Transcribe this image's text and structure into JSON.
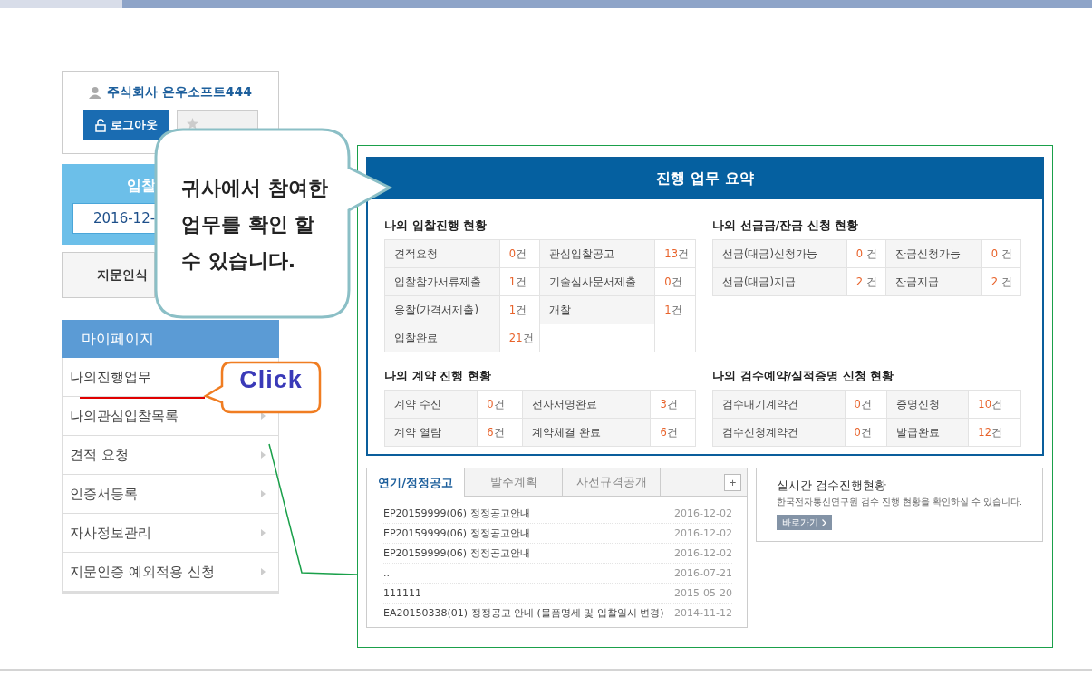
{
  "user": {
    "name": "주식회사 은우소프트444",
    "logout": "로그아웃"
  },
  "bid_box": {
    "title": "입찰",
    "date": "2016-12-"
  },
  "fingerprint_button": "지문인식",
  "mypage": {
    "title": "마이페이지",
    "items": [
      {
        "label": "나의진행업무"
      },
      {
        "label": "나의관심입찰목록",
        "arrow": true
      },
      {
        "label": "견적 요청",
        "arrow": true
      },
      {
        "label": "인증서등록",
        "arrow": true
      },
      {
        "label": "자사정보관리",
        "arrow": true
      },
      {
        "label": "지문인증 예외적용 신청",
        "arrow": true
      }
    ]
  },
  "summary": {
    "title": "진행 업무 요약",
    "sections": [
      {
        "title": "나의 입찰진행 현황",
        "rows": [
          [
            {
              "label": "견적요청",
              "count": "0",
              "unit": "건"
            },
            {
              "label": "관심입찰공고",
              "count": "13",
              "unit": "건"
            }
          ],
          [
            {
              "label": "입찰참가서류제출",
              "count": "1",
              "unit": "건"
            },
            {
              "label": "기술심사문서제출",
              "count": "0",
              "unit": "건"
            }
          ],
          [
            {
              "label": "응찰(가격서제출)",
              "count": "1",
              "unit": "건"
            },
            {
              "label": "개찰",
              "count": "1",
              "unit": "건"
            }
          ],
          [
            {
              "label": "입찰완료",
              "count": "21",
              "unit": "건"
            }
          ]
        ]
      },
      {
        "title": "나의 선급금/잔금 신청 현황",
        "rows": [
          [
            {
              "label": "선금(대금)신청가능",
              "count": "0",
              "unit": " 건"
            },
            {
              "label": "잔금신청가능",
              "count": "0",
              "unit": " 건"
            }
          ],
          [
            {
              "label": "선금(대금)지급",
              "count": "2",
              "unit": " 건"
            },
            {
              "label": "잔금지급",
              "count": "2",
              "unit": " 건"
            }
          ]
        ]
      },
      {
        "title": "나의 계약 진행 현황",
        "rows": [
          [
            {
              "label": "계약 수신",
              "count": "0",
              "unit": "건"
            },
            {
              "label": "전자서명완료",
              "count": "3",
              "unit": "건"
            }
          ],
          [
            {
              "label": "계약 열람",
              "count": "6",
              "unit": "건"
            },
            {
              "label": "계약체결 완료",
              "count": "6",
              "unit": "건"
            }
          ]
        ]
      },
      {
        "title": "나의 검수예약/실적증명 신청 현황",
        "rows": [
          [
            {
              "label": "검수대기계약건",
              "count": "0",
              "unit": "건"
            },
            {
              "label": "증명신청",
              "count": "10",
              "unit": "건"
            }
          ],
          [
            {
              "label": "검수신청계약건",
              "count": "0",
              "unit": "건"
            },
            {
              "label": "발급완료",
              "count": "12",
              "unit": "건"
            }
          ]
        ]
      }
    ]
  },
  "notices": {
    "tabs": [
      {
        "label": "연기/정정공고",
        "selected": true
      },
      {
        "label": "발주계획",
        "selected": false
      },
      {
        "label": "사전규격공개",
        "selected": false
      }
    ],
    "more": "+",
    "items": [
      {
        "title": "EP20159999(06) 정정공고안내",
        "date": "2016-12-02"
      },
      {
        "title": "EP20159999(06) 정정공고안내",
        "date": "2016-12-02"
      },
      {
        "title": "EP20159999(06) 정정공고안내",
        "date": "2016-12-02"
      },
      {
        "title": "..",
        "date": "2016-07-21"
      },
      {
        "title": "111111",
        "date": "2015-05-20"
      },
      {
        "title": "EA20150338(01) 정정공고 안내 (물품명세 및 입찰일시 변경)",
        "date": "2014-11-12"
      }
    ]
  },
  "inspection": {
    "title": "실시간 검수진행현황",
    "description": "한국전자통신연구원 검수 진행 현황을 확인하실 수 있습니다.",
    "button": "바로가기"
  },
  "callouts": [
    {
      "kind": "bubble",
      "text": "귀사에서 참여한\n업무를 확인 할\n수 있습니다."
    },
    {
      "kind": "click",
      "text": "Click"
    }
  ]
}
